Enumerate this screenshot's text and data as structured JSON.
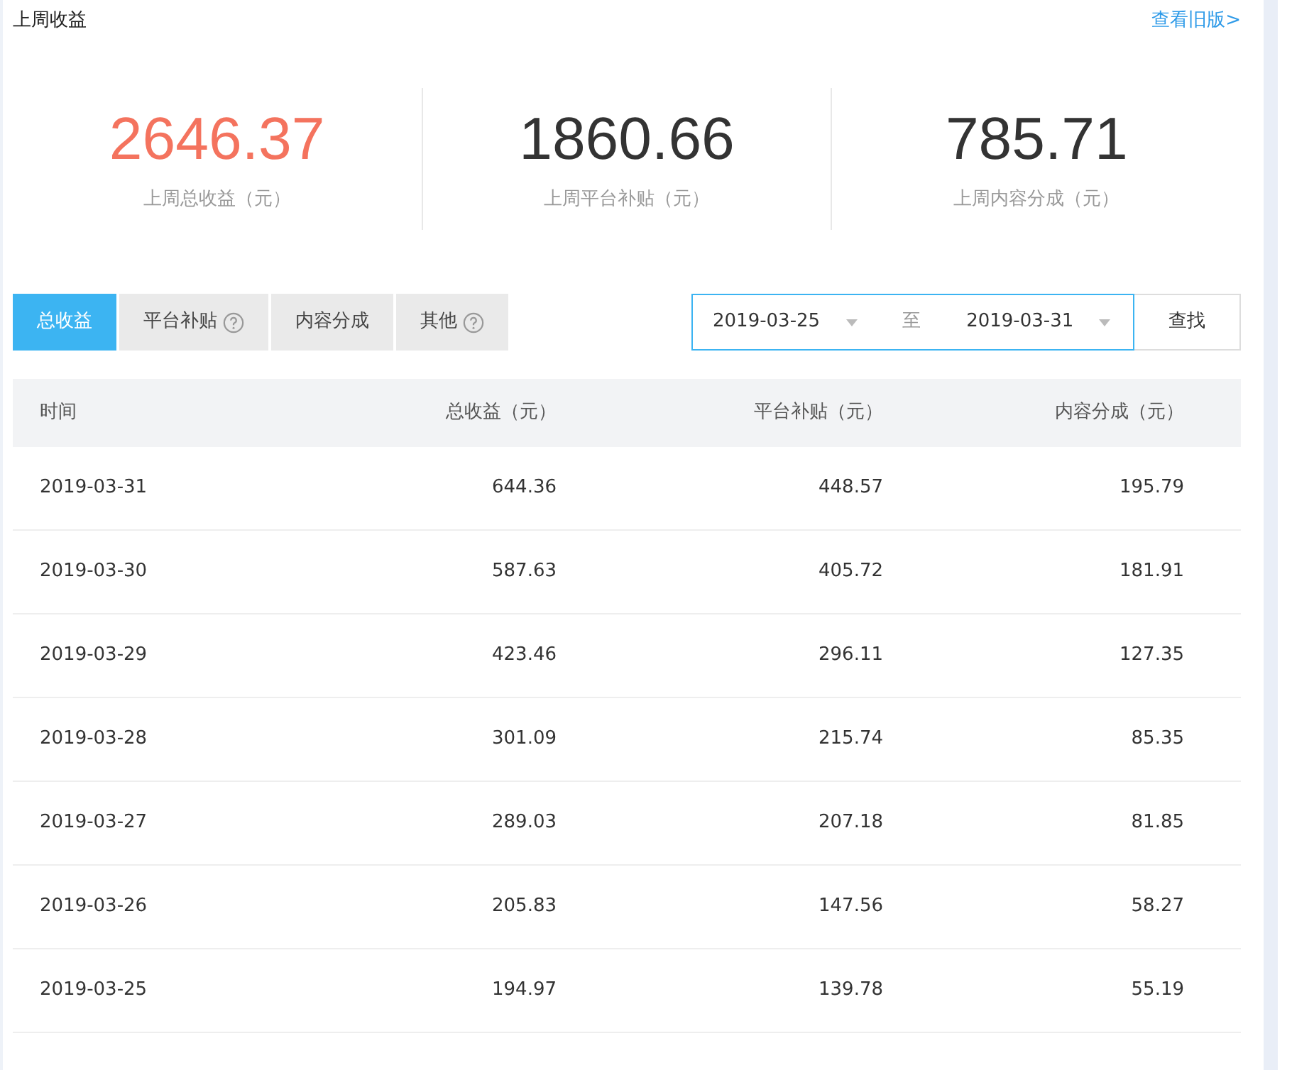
{
  "header": {
    "title": "上周收益",
    "link": "查看旧版>"
  },
  "stats": [
    {
      "value": "2646.37",
      "label": "上周总收益（元）",
      "highlight": true
    },
    {
      "value": "1860.66",
      "label": "上周平台补贴（元）",
      "highlight": false
    },
    {
      "value": "785.71",
      "label": "上周内容分成（元）",
      "highlight": false
    }
  ],
  "tabs": [
    {
      "label": "总收益",
      "selected": true,
      "help": false
    },
    {
      "label": "平台补贴",
      "selected": false,
      "help": true
    },
    {
      "label": "内容分成",
      "selected": false,
      "help": false
    },
    {
      "label": "其他",
      "selected": false,
      "help": true
    }
  ],
  "date_range": {
    "start": "2019-03-25",
    "separator": "至",
    "end": "2019-03-31",
    "button": "查找"
  },
  "table": {
    "columns": [
      "时间",
      "总收益（元）",
      "平台补贴（元）",
      "内容分成（元）"
    ],
    "rows": [
      {
        "cells": [
          "2019-03-31",
          "644.36",
          "448.57",
          "195.79"
        ]
      },
      {
        "cells": [
          "2019-03-30",
          "587.63",
          "405.72",
          "181.91"
        ]
      },
      {
        "cells": [
          "2019-03-29",
          "423.46",
          "296.11",
          "127.35"
        ]
      },
      {
        "cells": [
          "2019-03-28",
          "301.09",
          "215.74",
          "85.35"
        ]
      },
      {
        "cells": [
          "2019-03-27",
          "289.03",
          "207.18",
          "81.85"
        ]
      },
      {
        "cells": [
          "2019-03-26",
          "205.83",
          "147.56",
          "58.27"
        ]
      },
      {
        "cells": [
          "2019-03-25",
          "194.97",
          "139.78",
          "55.19"
        ]
      }
    ]
  }
}
